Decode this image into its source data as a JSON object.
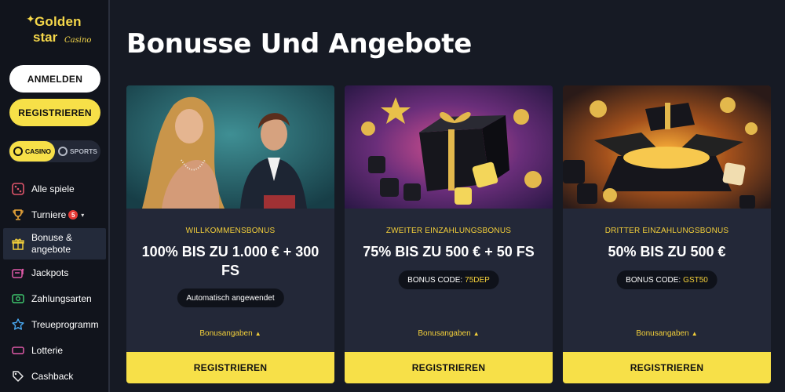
{
  "brand": {
    "line1": "Golden",
    "line2": "star",
    "line3": "Casino"
  },
  "sidebar": {
    "login_label": "ANMELDEN",
    "register_label": "REGISTRIEREN",
    "toggle": {
      "casino": "CASINO",
      "sports": "SPORTS"
    },
    "items": [
      {
        "label": "Alle spiele"
      },
      {
        "label": "Turniere",
        "badge": "5"
      },
      {
        "label": "Bonuse &",
        "label2": "angebote"
      },
      {
        "label": "Jackpots"
      },
      {
        "label": "Zahlungsarten"
      },
      {
        "label": "Treueprogramm"
      },
      {
        "label": "Lotterie"
      },
      {
        "label": "Cashback"
      }
    ]
  },
  "main": {
    "title": "Bonusse Und Angebote",
    "cards": [
      {
        "label": "WILLKOMMENSBONUS",
        "headline": "100% BIS ZU 1.000 € + 300 FS",
        "pill": "Automatisch angewendet",
        "details": "Bonusangaben",
        "cta": "REGISTRIEREN"
      },
      {
        "label": "ZWEITER EINZAHLUNGSBONUS",
        "headline": "75% BIS ZU 500 € + 50 FS",
        "pill_prefix": "BONUS CODE:",
        "pill_code": "75DEP",
        "details": "Bonusangaben",
        "cta": "REGISTRIEREN"
      },
      {
        "label": "DRITTER EINZAHLUNGSBONUS",
        "headline": "50% BIS ZU 500 €",
        "pill_prefix": "BONUS CODE:",
        "pill_code": "GST50",
        "details": "Bonusangaben",
        "cta": "REGISTRIEREN"
      }
    ]
  },
  "colors": {
    "accent": "#f7e048",
    "gold_text": "#f3cf3a",
    "bg": "#161a24",
    "card": "#232838"
  }
}
